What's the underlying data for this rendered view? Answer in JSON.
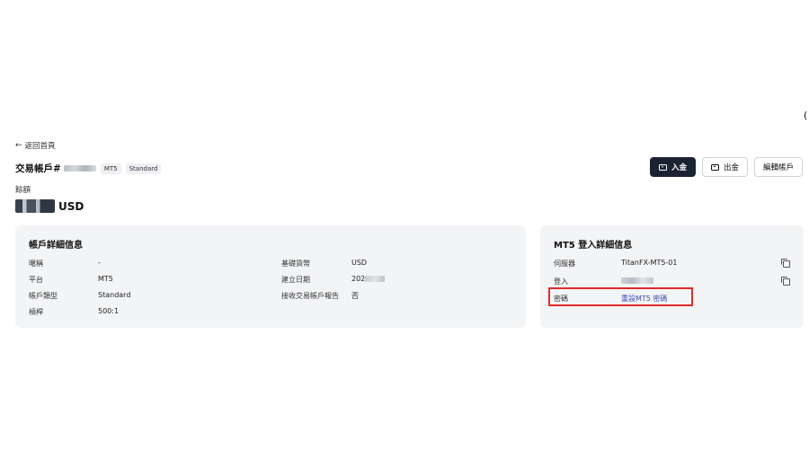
{
  "edge_glyph": "(",
  "nav": {
    "back_label": "返回首頁"
  },
  "header": {
    "title_prefix": "交易帳戶#",
    "platform_chip": "MT5",
    "type_chip": "Standard"
  },
  "actions": {
    "deposit": "入金",
    "withdraw": "出金",
    "edit": "編輯帳戶"
  },
  "balance": {
    "label": "餘額",
    "currency": "USD"
  },
  "account_details": {
    "title": "帳戶詳細信息",
    "nickname_label": "暱稱",
    "nickname_value": "-",
    "platform_label": "平台",
    "platform_value": "MT5",
    "type_label": "帳戶類型",
    "type_value": "Standard",
    "leverage_label": "槓桿",
    "leverage_value": "500:1",
    "base_currency_label": "基礎貨幣",
    "base_currency_value": "USD",
    "created_label": "建立日期",
    "created_value": "202",
    "report_label": "接收交易帳戶報告",
    "report_value": "否"
  },
  "mt5_details": {
    "title": "MT5 登入詳細信息",
    "server_label": "伺服器",
    "server_value": "TitanFX-MT5-01",
    "login_label": "登入",
    "password_label": "密碼",
    "password_link": "重設MT5 密碼"
  },
  "colors": {
    "primary_button": "#1b2233",
    "card_bg": "#f3f4f6",
    "link": "#3b4ab0",
    "highlight": "#e02b2b"
  }
}
